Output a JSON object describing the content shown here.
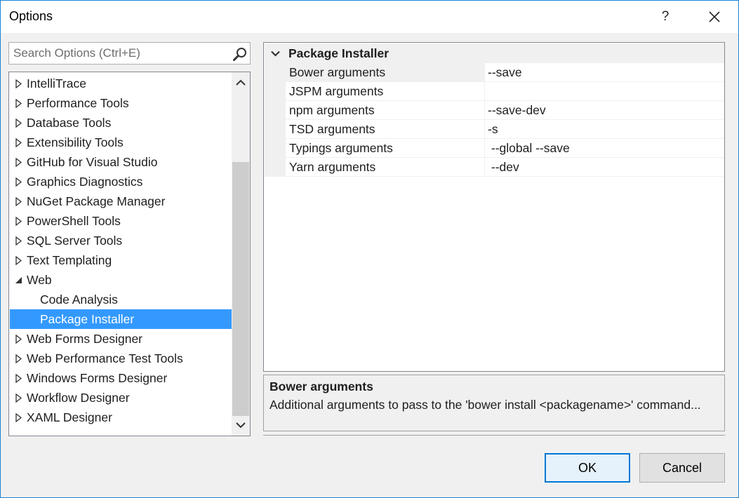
{
  "window": {
    "title": "Options",
    "help_label": "?"
  },
  "search": {
    "placeholder": "Search Options (Ctrl+E)"
  },
  "tree": {
    "items": [
      {
        "label": "IntelliTrace",
        "type": "collapsed"
      },
      {
        "label": "Performance Tools",
        "type": "collapsed"
      },
      {
        "label": "Database Tools",
        "type": "collapsed"
      },
      {
        "label": "Extensibility Tools",
        "type": "collapsed"
      },
      {
        "label": "GitHub for Visual Studio",
        "type": "collapsed"
      },
      {
        "label": "Graphics Diagnostics",
        "type": "collapsed"
      },
      {
        "label": "NuGet Package Manager",
        "type": "collapsed"
      },
      {
        "label": "PowerShell Tools",
        "type": "collapsed"
      },
      {
        "label": "SQL Server Tools",
        "type": "collapsed"
      },
      {
        "label": "Text Templating",
        "type": "collapsed"
      },
      {
        "label": "Web",
        "type": "expanded"
      },
      {
        "label": "Code Analysis",
        "type": "child"
      },
      {
        "label": "Package Installer",
        "type": "child",
        "selected": true
      },
      {
        "label": "Web Forms Designer",
        "type": "collapsed"
      },
      {
        "label": "Web Performance Test Tools",
        "type": "collapsed"
      },
      {
        "label": "Windows Forms Designer",
        "type": "collapsed"
      },
      {
        "label": "Workflow Designer",
        "type": "collapsed"
      },
      {
        "label": "XAML Designer",
        "type": "collapsed"
      }
    ]
  },
  "grid": {
    "category": "Package Installer",
    "rows": [
      {
        "name": "Bower arguments",
        "value": "--save"
      },
      {
        "name": "JSPM arguments",
        "value": ""
      },
      {
        "name": "npm arguments",
        "value": "--save-dev"
      },
      {
        "name": "TSD arguments",
        "value": "-s"
      },
      {
        "name": "Typings arguments",
        "value": " --global --save"
      },
      {
        "name": "Yarn arguments",
        "value": " --dev"
      }
    ]
  },
  "description": {
    "title": "Bower arguments",
    "text": "Additional arguments to pass to the 'bower install <packagename>' command..."
  },
  "buttons": {
    "ok": "OK",
    "cancel": "Cancel"
  },
  "colors": {
    "selection": "#3399ff",
    "accent": "#0078d7",
    "border": "#1883d7"
  }
}
